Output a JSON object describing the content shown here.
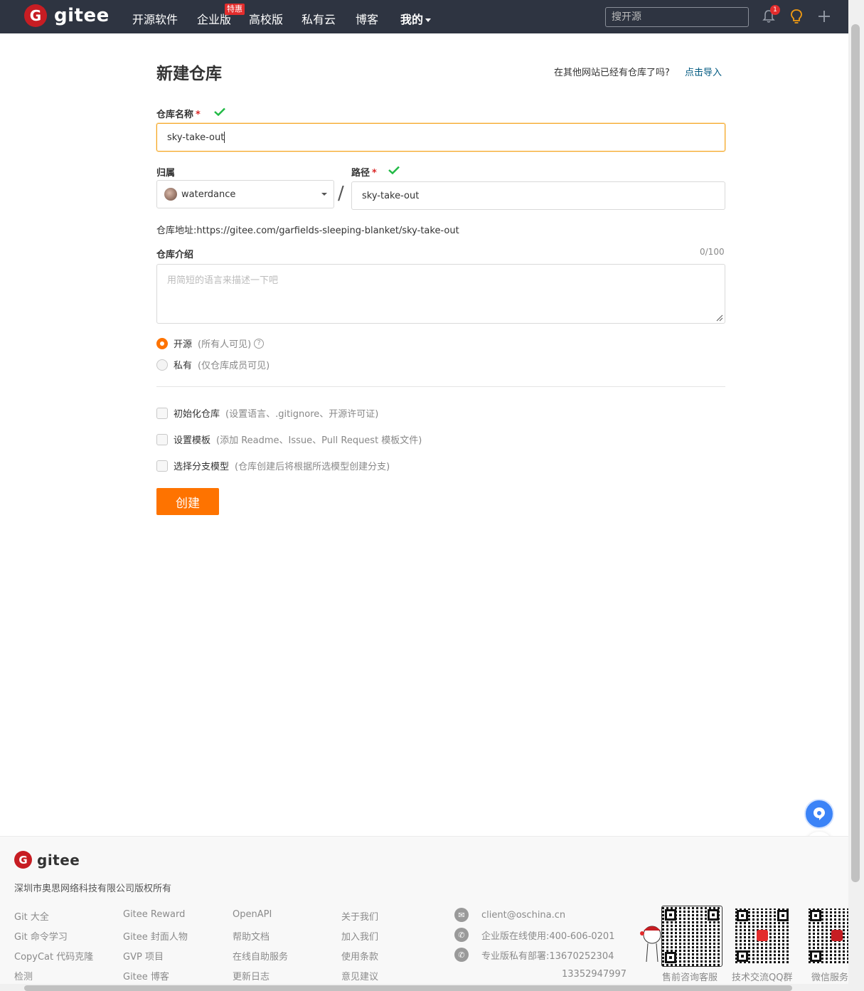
{
  "header": {
    "logo_text": "gitee",
    "logo_glyph": "G",
    "nav": [
      "开源软件",
      "企业版",
      "高校版",
      "私有云",
      "博客",
      "我的"
    ],
    "nav_badge": "特惠",
    "search_placeholder": "搜开源",
    "notification_count": "1"
  },
  "page": {
    "title": "新建仓库",
    "import_prompt": "在其他网站已经有仓库了吗?",
    "import_link": "点击导入"
  },
  "form": {
    "repo_name_label": "仓库名称",
    "required_mark": "*",
    "repo_name_value": "sky-take-out",
    "owner_label": "归属",
    "owner_value": "waterdance",
    "path_label": "路径",
    "path_value": "sky-take-out",
    "slash": "/",
    "repo_address": "仓库地址:https://gitee.com/garfields-sleeping-blanket/sky-take-out",
    "description_label": "仓库介绍",
    "description_counter": "0/100",
    "description_placeholder": "用简短的语言来描述一下吧",
    "visibility": [
      {
        "label": "开源",
        "hint": "(所有人可见)",
        "selected": true
      },
      {
        "label": "私有",
        "hint": "(仅仓库成员可见)",
        "selected": false
      }
    ],
    "options": [
      {
        "label": "初始化仓库",
        "hint": "(设置语言、.gitignore、开源许可证)"
      },
      {
        "label": "设置模板",
        "hint": "(添加 Readme、Issue、Pull Request 模板文件)"
      },
      {
        "label": "选择分支模型",
        "hint": "(仓库创建后将根据所选模型创建分支)"
      }
    ],
    "submit_label": "创建"
  },
  "footer": {
    "logo_text": "gitee",
    "copyright": "深圳市奥思网络科技有限公司版权所有",
    "col1": [
      "Git 大全",
      "Git 命令学习",
      "CopyCat 代码克隆",
      "检测"
    ],
    "col2": [
      "Gitee Reward",
      "Gitee 封面人物",
      "GVP 项目",
      "Gitee 博客"
    ],
    "col3": [
      "OpenAPI",
      "帮助文档",
      "在线自助服务",
      "更新日志"
    ],
    "col4": [
      "关于我们",
      "加入我们",
      "使用条款",
      "意见建议"
    ],
    "contacts": [
      "client@oschina.cn",
      "企业版在线使用:400-606-0201",
      "专业版私有部署:13670252304",
      "13352947997"
    ],
    "qr_labels": [
      "售前咨询客服",
      "技术交流QQ群",
      "微信服务"
    ]
  },
  "colors": {
    "header_bg": "#2e3441",
    "brand_red": "#c71d23",
    "accent_orange": "#fe7300",
    "check_green": "#21ba45",
    "link_blue": "#005980"
  },
  "icons": [
    "bell-icon",
    "lightbulb-icon",
    "plus-icon",
    "checkmark-icon",
    "help-circle-icon",
    "mail-icon",
    "phone-icon",
    "chat-bubble-icon",
    "edit-icon"
  ]
}
